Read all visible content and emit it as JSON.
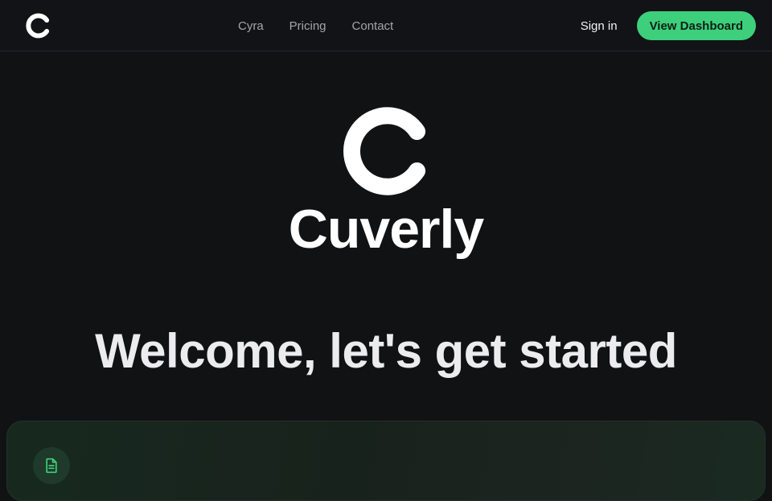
{
  "nav": {
    "logo_icon": "cuverly-c-logo-icon",
    "links": [
      "Cyra",
      "Pricing",
      "Contact"
    ],
    "signin_label": "Sign in",
    "cta_label": "View Dashboard"
  },
  "hero": {
    "logo_icon": "cuverly-c-logo-icon",
    "brand_name": "Cuverly",
    "welcome_heading": "Welcome, let's get started"
  },
  "card": {
    "icon": "document-icon"
  },
  "colors": {
    "background": "#111214",
    "accent": "#3ecf7c",
    "card_icon_bg": "#1f3a2a"
  }
}
